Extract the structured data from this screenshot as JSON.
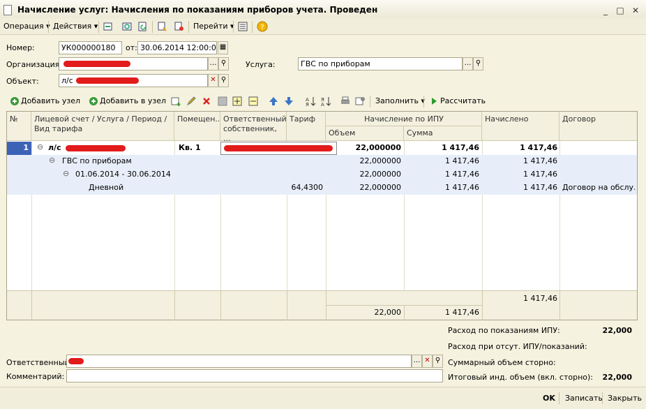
{
  "window": {
    "title": "Начисление услуг: Начисления по показаниям приборов учета. Проведен"
  },
  "toolbar": {
    "operation": "Операция",
    "actions": "Действия",
    "goto": "Перейти"
  },
  "form": {
    "number_label": "Номер:",
    "number_value": "УК000000180",
    "date_label": "от:",
    "date_value": "30.06.2014 12:00:03",
    "org_label": "Организация:",
    "service_label": "Услуга:",
    "service_value": "ГВС по приборам",
    "object_label": "Объект:",
    "object_value": "л/с"
  },
  "grid_toolbar": {
    "add_node": "Добавить узел",
    "add_in_node": "Добавить в узел",
    "fill": "Заполнить",
    "calculate": "Рассчитать"
  },
  "grid": {
    "headers": {
      "n": "№",
      "account": "Лицевой счет / Услуга / Период / Вид тарифа",
      "room": "Помещен...",
      "owner": "Ответственный собственник, ...",
      "tariff": "Тариф",
      "ipu_group": "Начисление по ИПУ",
      "volume": "Объем",
      "sum": "Сумма",
      "charged": "Начислено",
      "contract": "Договор"
    },
    "rows": [
      {
        "n": "1",
        "account": "л/с",
        "room": "Кв. 1",
        "tariff": "",
        "volume": "22,000000",
        "sum": "1 417,46",
        "charged": "1 417,46",
        "contract": ""
      },
      {
        "n": "",
        "account": "ГВС по приборам",
        "room": "",
        "tariff": "",
        "volume": "22,000000",
        "sum": "1 417,46",
        "charged": "1 417,46",
        "contract": ""
      },
      {
        "n": "",
        "account": "01.06.2014 - 30.06.2014",
        "room": "",
        "tariff": "",
        "volume": "22,000000",
        "sum": "1 417,46",
        "charged": "1 417,46",
        "contract": ""
      },
      {
        "n": "",
        "account": "Дневной",
        "room": "",
        "tariff": "64,4300",
        "volume": "22,000000",
        "sum": "1 417,46",
        "charged": "1 417,46",
        "contract": "Договор на обслу..."
      }
    ],
    "footer": {
      "volume": "22,000",
      "sum": "1 417,46",
      "charged": "1 417,46"
    }
  },
  "summary": {
    "rashod_label": "Расход по показаниям ИПУ:",
    "rashod_value": "22,000",
    "otsut_label": "Расход при отсут. ИПУ/показаний:",
    "storno_label": "Суммарный объем сторно:",
    "itog_label": "Итоговый инд. объем (вкл. сторно):",
    "itog_value": "22,000"
  },
  "bottom": {
    "responsible_label": "Ответственный:",
    "comment_label": "Комментарий:",
    "ok": "OK",
    "save": "Записать",
    "close": "Закрыть"
  },
  "colors": {
    "background": "#f5f2df",
    "selection": "#3d63b7",
    "redaction": "#e21b1b",
    "row_highlight": "#e8eef9"
  }
}
